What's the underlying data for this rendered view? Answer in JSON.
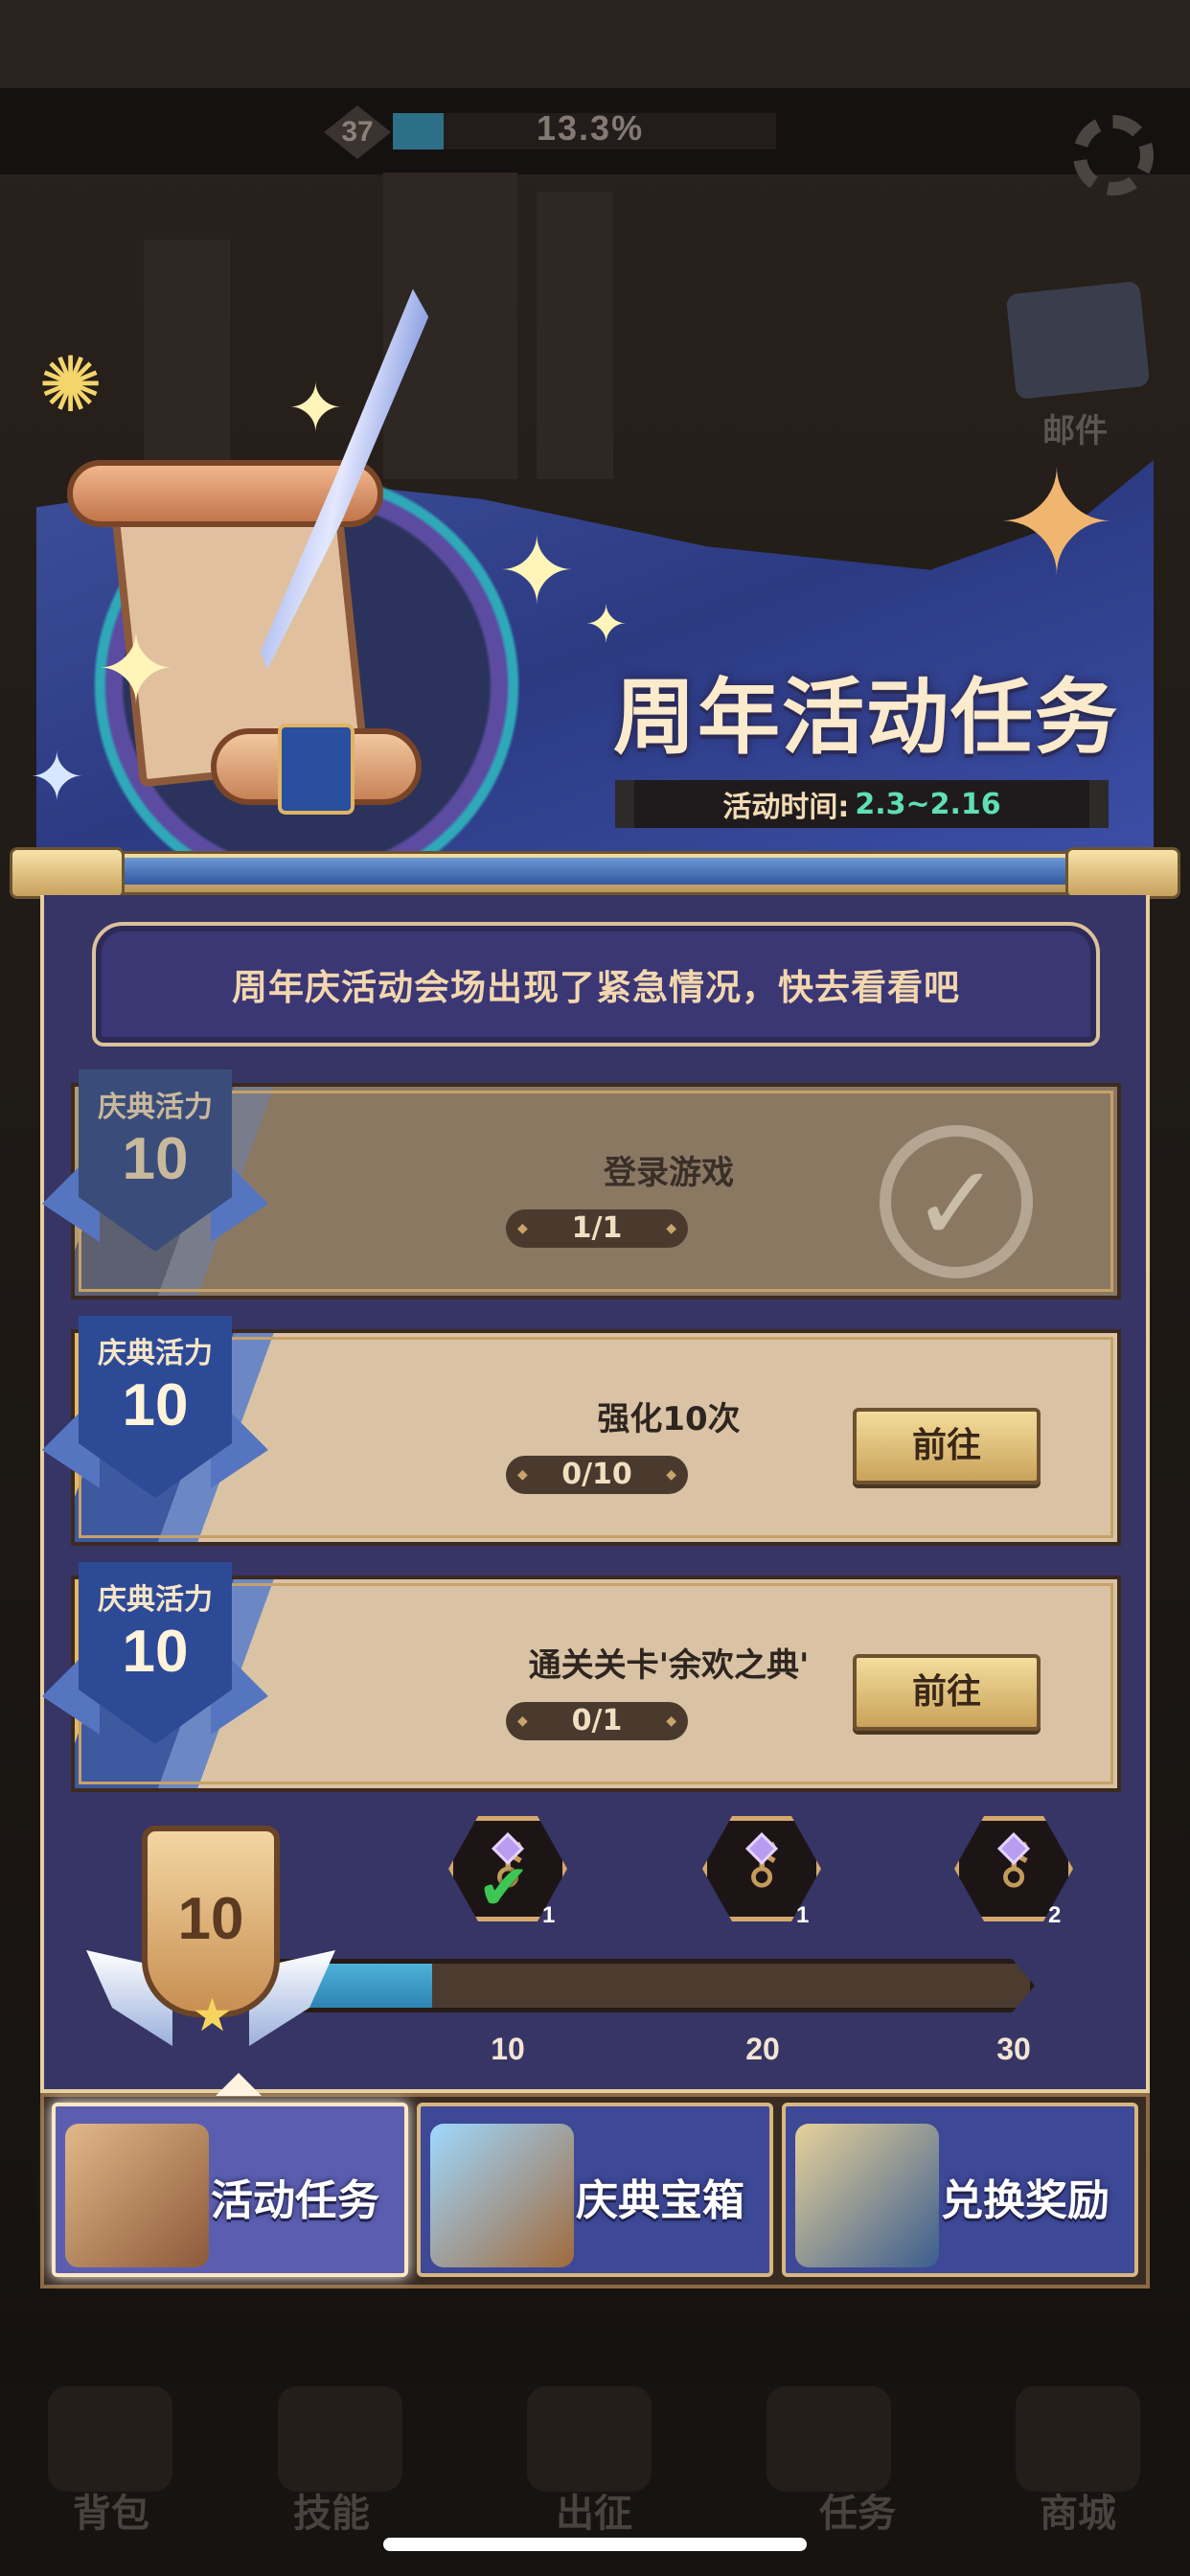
{
  "hud": {
    "level": "37",
    "exp_percent": "13.3%",
    "exp_fraction": 0.133
  },
  "side": {
    "mail_label": "邮件"
  },
  "banner": {
    "title": "周年活动任务",
    "time_label": "活动时间:",
    "time_value": "2.3~2.16"
  },
  "notice": "周年庆活动会场出现了紧急情况，快去看看吧",
  "tasks": [
    {
      "badge_label": "庆典活力",
      "points": "10",
      "name": "登录游戏",
      "progress": "1/1",
      "status": "completed"
    },
    {
      "badge_label": "庆典活力",
      "points": "10",
      "name": "强化10次",
      "progress": "0/10",
      "button": "前往",
      "status": "open"
    },
    {
      "badge_label": "庆典活力",
      "points": "10",
      "name": "通关关卡'余欢之典'",
      "progress": "0/1",
      "button": "前往",
      "status": "open"
    }
  ],
  "progress": {
    "current": "10",
    "fraction": 0.2,
    "milestones": [
      {
        "value": "10",
        "reward_count": "1",
        "claimed": true
      },
      {
        "value": "20",
        "reward_count": "1",
        "claimed": false
      },
      {
        "value": "30",
        "reward_count": "2",
        "claimed": false
      }
    ]
  },
  "tabs": [
    {
      "label": "活动任务",
      "active": true
    },
    {
      "label": "庆典宝箱",
      "active": false
    },
    {
      "label": "兑换奖励",
      "active": false
    }
  ],
  "bottom_nav": [
    "背包",
    "技能",
    "出征",
    "任务",
    "商城"
  ],
  "icons": {
    "gear": "gear-icon",
    "mail": "mail-icon",
    "check": "checkmark-icon",
    "key": "key-icon",
    "star": "star-icon"
  },
  "colors": {
    "panel": "#373566",
    "accent_gold": "#e7cf9e",
    "progress_fill": "#2d84b3",
    "time_value": "#5ee0b3"
  }
}
